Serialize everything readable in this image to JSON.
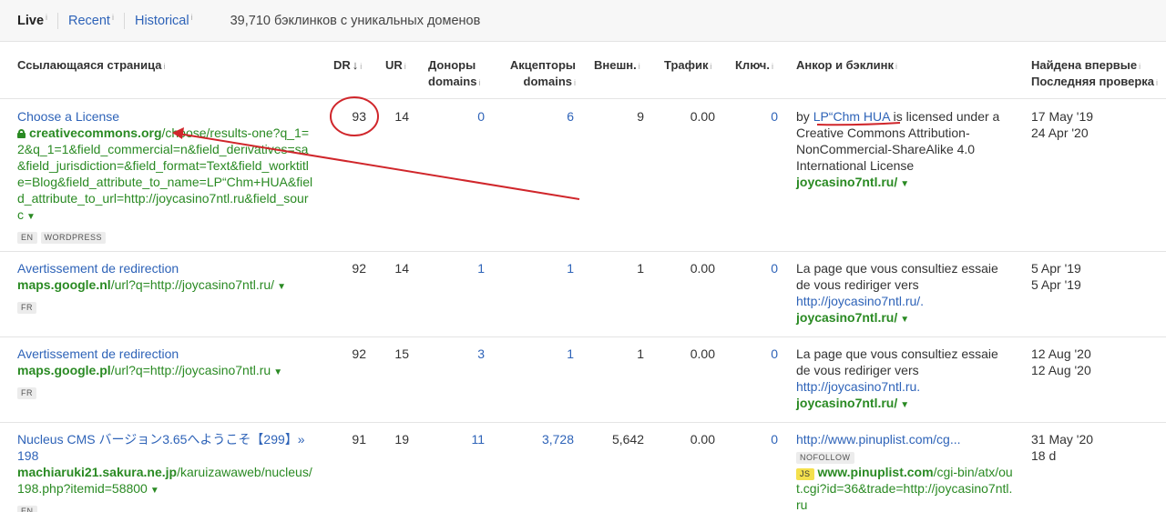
{
  "tabs": [
    {
      "label": "Live",
      "active": true
    },
    {
      "label": "Recent",
      "active": false
    },
    {
      "label": "Historical",
      "active": false
    }
  ],
  "summary": "39,710 бэклинков с уникальных доменов",
  "headers": {
    "page": "Ссылающаяся страница",
    "dr": "DR",
    "dr_sort": "↓",
    "ur": "UR",
    "donors_1": "Доноры",
    "donors_2": "domains",
    "acceptors_1": "Акцепторы",
    "acceptors_2": "domains",
    "external": "Внешн.",
    "traffic": "Трафик",
    "keywords": "Ключ.",
    "anchor": "Анкор и бэклинк",
    "first_seen": "Найдена впервые",
    "last_check": "Последняя проверка"
  },
  "rows": [
    {
      "title": "Choose a License",
      "url_domain": "creativecommons.org",
      "url_path": "/choose/results-one?q_1=2&q_1=1&field_commercial=n&field_derivatives=sa&field_jurisdiction=&field_format=Text&field_worktitle=Blog&field_attribute_to_name=LP“Chm+HUA&field_attribute_to_url=http://joycasino7ntl.ru&field_sourc",
      "badges": [
        "EN",
        "WORDPRESS"
      ],
      "dr": "93",
      "ur": "14",
      "donors": "0",
      "acceptors": "6",
      "external": "9",
      "traffic": "0.00",
      "keywords": "0",
      "anchor_prefix": "by ",
      "anchor_link": "LP“Chm HUA",
      "anchor_suffix": " is licensed under a Creative Commons Attribution-NonCommercial-ShareAlike 4.0 International License",
      "target": "joycasino7ntl.ru/",
      "first_seen": "17 May '19",
      "last_check": "24 Apr '20"
    },
    {
      "title": "Avertissement de redirection",
      "url_domain": "maps.google.nl",
      "url_path": "/url?q=http://joycasino7ntl.ru/",
      "badges": [
        "FR"
      ],
      "dr": "92",
      "ur": "14",
      "donors": "1",
      "acceptors": "1",
      "external": "1",
      "traffic": "0.00",
      "keywords": "0",
      "anchor_text": "La page que vous consultiez essaie de vous rediriger vers",
      "anchor_url": "http://joycasino7ntl.ru/.",
      "target": "joycasino7ntl.ru/",
      "first_seen": "5 Apr '19",
      "last_check": "5 Apr '19"
    },
    {
      "title": "Avertissement de redirection",
      "url_domain": "maps.google.pl",
      "url_path": "/url?q=http://joycasino7ntl.ru",
      "badges": [
        "FR"
      ],
      "dr": "92",
      "ur": "15",
      "donors": "3",
      "acceptors": "1",
      "external": "1",
      "traffic": "0.00",
      "keywords": "0",
      "anchor_text": "La page que vous consultiez essaie de vous rediriger vers",
      "anchor_url": "http://joycasino7ntl.ru.",
      "target": "joycasino7ntl.ru/",
      "first_seen": "12 Aug '20",
      "last_check": "12 Aug '20"
    },
    {
      "title": "Nucleus CMS バージョン3.65へようこそ【299】» 198",
      "url_domain": "machiaruki21.sakura.ne.jp",
      "url_path": "/karuizawaweb/nucleus/198.php?itemid=58800",
      "badges": [
        "EN"
      ],
      "dr": "91",
      "ur": "19",
      "donors": "11",
      "acceptors": "3,728",
      "external": "5,642",
      "traffic": "0.00",
      "keywords": "0",
      "anchor_url": "http://www.pinuplist.com/cg...",
      "anchor_badge": "NOFOLLOW",
      "target_badge": "JS",
      "target_domain": "www.pinuplist.com",
      "target_path": "/cgi-bin/atx/out.cgi?id=36&trade=http://joycasino7ntl.ru",
      "first_seen": "31 May '20",
      "last_check": "18 d"
    }
  ],
  "colors": {
    "link": "#2e63b8",
    "url": "#2a8a23",
    "annotation": "#d0262b"
  }
}
